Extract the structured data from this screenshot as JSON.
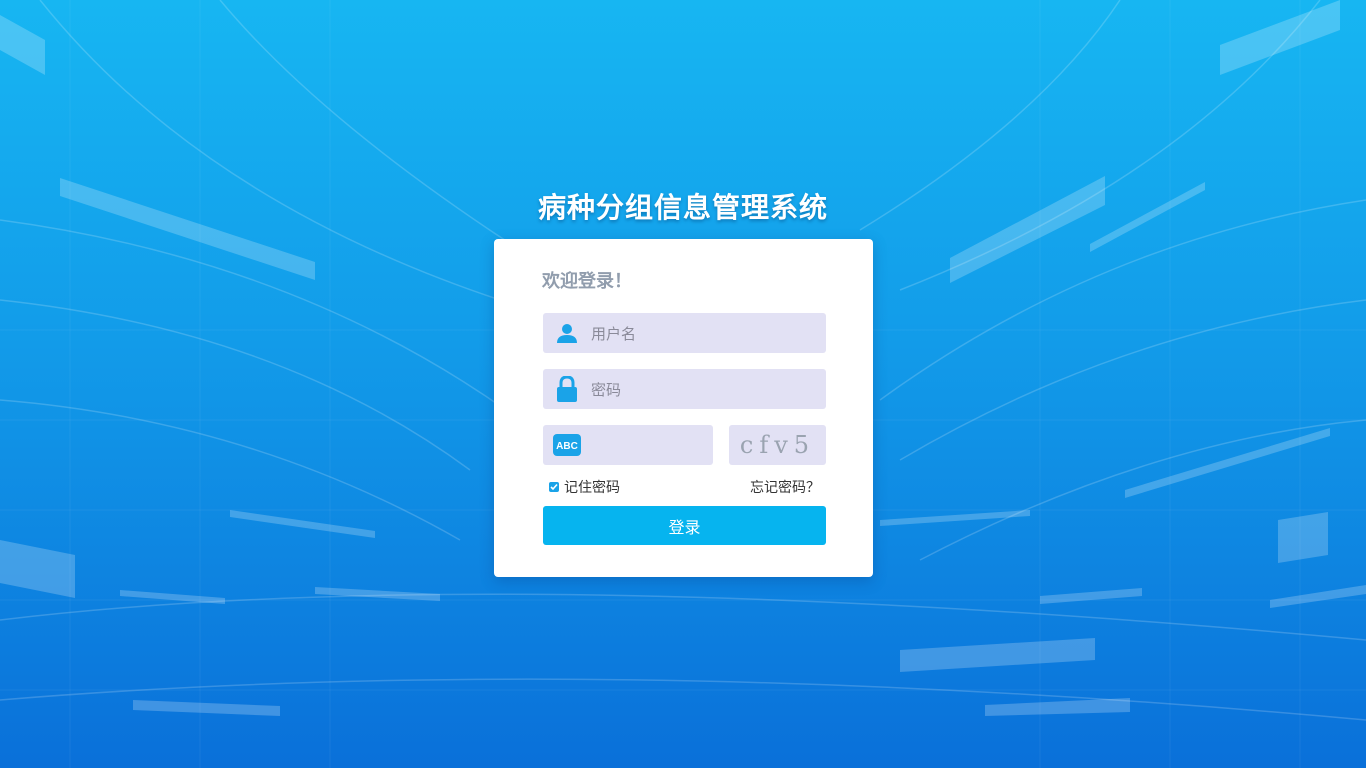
{
  "app": {
    "title": "病种分组信息管理系统"
  },
  "login": {
    "welcome": "欢迎登录！",
    "username_placeholder": "用户名",
    "password_placeholder": "密码",
    "captcha_text": "cfv5",
    "remember_label": "记住密码",
    "remember_checked": true,
    "forgot_label": "忘记密码？",
    "submit_label": "登录"
  },
  "icons": {
    "username": "user-icon",
    "password": "lock-icon",
    "captcha": "abc-icon",
    "remember": "checkbox-icon"
  },
  "colors": {
    "title": "#FFFFFF",
    "welcome": "#919DAD",
    "accent": "#06B4EF",
    "input_bg": "#E2E1F4"
  }
}
